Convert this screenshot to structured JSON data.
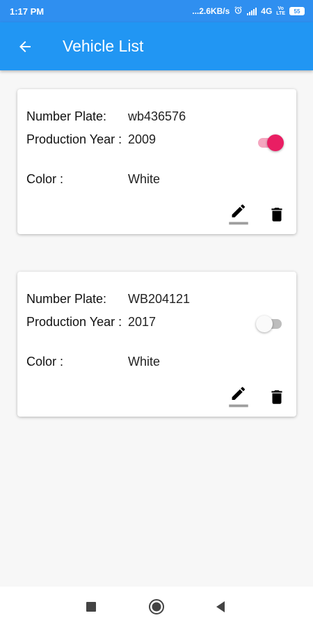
{
  "status_bar": {
    "time": "1:17 PM",
    "network_speed": "...2.6KB/s",
    "network_type": "4G",
    "volte_line1": "Vo",
    "volte_line2": "LTE",
    "battery": "55"
  },
  "app_bar": {
    "title": "Vehicle List",
    "back_icon": "arrow-back-icon"
  },
  "vehicles": [
    {
      "number_plate_label": "Number Plate:",
      "number_plate": "wb436576",
      "production_year_label": "Production Year :",
      "production_year": "2009",
      "color_label": "Color :",
      "color": "White",
      "switch_on": true,
      "edit_icon": "edit-icon",
      "delete_icon": "delete-icon"
    },
    {
      "number_plate_label": "Number Plate:",
      "number_plate": "WB204121",
      "production_year_label": "Production Year :",
      "production_year": "2017",
      "color_label": "Color :",
      "color": "White",
      "switch_on": false,
      "edit_icon": "edit-icon",
      "delete_icon": "delete-icon"
    }
  ],
  "colors": {
    "app_bar": "#2196f3",
    "status_bar": "#2f8ff0",
    "switch_on": "#e91e63"
  },
  "nav_bar": {
    "recents_icon": "square-icon",
    "home_icon": "circle-icon",
    "back_icon": "triangle-back-icon"
  }
}
